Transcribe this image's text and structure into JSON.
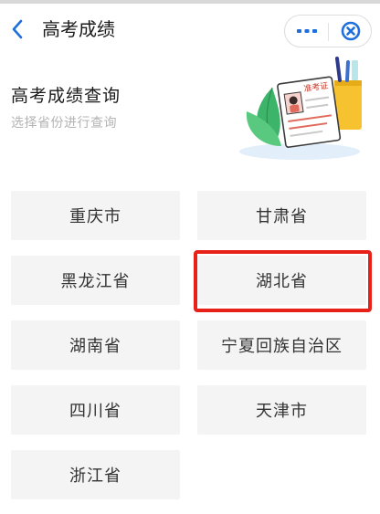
{
  "nav": {
    "title": "高考成绩",
    "back_icon": "chevron-left-icon",
    "more_icon": "more-dots-icon",
    "close_icon": "close-circle-icon"
  },
  "hero": {
    "title": "高考成绩查询",
    "subtitle": "选择省份进行查询",
    "illustration_badge": "准考证"
  },
  "provinces": [
    "重庆市",
    "甘肃省",
    "黑龙江省",
    "湖北省",
    "湖南省",
    "宁夏回族自治区",
    "四川省",
    "天津市",
    "浙江省"
  ],
  "highlighted_province": "湖北省",
  "colors": {
    "accent_blue": "#1e6fdc",
    "highlight_red": "#e8201a",
    "tile_bg": "#f4f4f4"
  }
}
